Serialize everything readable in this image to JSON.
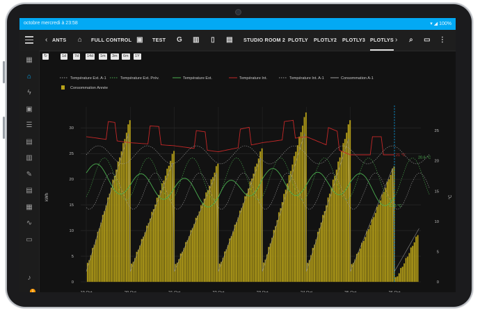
{
  "status_bar": {
    "datetime": "octobre mercredi à 23:58",
    "battery": "100%"
  },
  "toolbar": {
    "tabs": [
      {
        "label": "ANTS",
        "type": "text"
      },
      {
        "label": "",
        "type": "icon",
        "icon": "sofa-icon"
      },
      {
        "label": "FULL CONTROL",
        "type": "text"
      },
      {
        "label": "",
        "type": "icon",
        "icon": "tv-icon"
      },
      {
        "label": "TEST",
        "type": "text"
      },
      {
        "label": "G",
        "type": "icon",
        "icon": "google-icon"
      },
      {
        "label": "",
        "type": "icon",
        "icon": "bar-chart-icon"
      },
      {
        "label": "",
        "type": "icon",
        "icon": "cellphone-icon"
      },
      {
        "label": "",
        "type": "icon",
        "icon": "image-icon"
      },
      {
        "label": "STUDIO ROOM 2",
        "type": "text"
      },
      {
        "label": "PLOTLY",
        "type": "text"
      },
      {
        "label": "PLOTLY2",
        "type": "text"
      },
      {
        "label": "PLOTLY3",
        "type": "text"
      },
      {
        "label": "PLOTLYS",
        "type": "text",
        "active": true
      }
    ]
  },
  "range_buttons": [
    "1d",
    "7d",
    "14d",
    "1m",
    "3m",
    "6m",
    "1Y"
  ],
  "sidebar_icons": [
    "overview-icon",
    "home-icon",
    "energy-icon",
    "badge-icon",
    "list-icon",
    "logbook-icon",
    "calendar-icon",
    "wrench-icon",
    "history-icon",
    "office-icon",
    "chart-line-icon",
    "clipboard-icon"
  ],
  "notification_count": "1",
  "user_initial": "F",
  "chart_data": {
    "type": "line",
    "legend": [
      {
        "name": "Température Ext. A-1",
        "color": "#9e9e9e",
        "dash": "dotted"
      },
      {
        "name": "Température Ext. Prév.",
        "color": "#4caf50",
        "dash": "dotted"
      },
      {
        "name": "Température Ext.",
        "color": "#4caf50",
        "dash": "solid"
      },
      {
        "name": "Température Int.",
        "color": "#c62828",
        "dash": "solid"
      },
      {
        "name": "Température Int. A-1",
        "color": "#9e9e9e",
        "dash": "dotted"
      },
      {
        "name": "Consommation A-1",
        "color": "#9e9e9e",
        "dash": "solid"
      },
      {
        "name": "Consommation Année",
        "color": "#b8a21a",
        "dash": "bar"
      }
    ],
    "x_ticks": [
      "19 Oct\n2023",
      "20 Oct",
      "21 Oct",
      "22 Oct",
      "23 Oct",
      "24 Oct",
      "25 Oct",
      "26 Oct"
    ],
    "y_left": {
      "label": "kWh",
      "ticks": [
        0,
        5,
        10,
        15,
        20,
        25,
        30
      ],
      "range": [
        0,
        33
      ]
    },
    "y_right": {
      "label": "°C",
      "ticks": [
        0,
        5,
        10,
        15,
        20,
        25
      ],
      "range": [
        0,
        28
      ]
    },
    "annotations": [
      "21 °C",
      "20.6 °C",
      "12.6 °C"
    ],
    "consumption_daily_peaks_kwh": [
      31.5,
      25.5,
      23,
      26,
      33,
      31.5,
      22.5,
      18
    ],
    "temp_int_c": [
      24,
      23,
      22.5,
      21.5,
      23,
      24,
      21,
      21
    ],
    "temp_ext_c": [
      18,
      16,
      15.5,
      14,
      17,
      16,
      16.5,
      14,
      12.6
    ]
  }
}
